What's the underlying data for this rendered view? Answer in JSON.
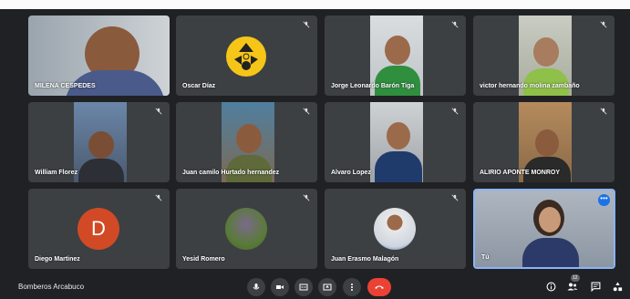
{
  "meeting": {
    "title": "Bomberos Arcabuco"
  },
  "participants": [
    {
      "name": "MILENA CESPEDES"
    },
    {
      "name": "Oscar Díaz"
    },
    {
      "name": "Jorge Leonardo Barón Tiga"
    },
    {
      "name": "victor hernando molina zambaño"
    },
    {
      "name": "William Florez"
    },
    {
      "name": "Juan camilo Hurtado hernandez"
    },
    {
      "name": "Alvaro Lopez"
    },
    {
      "name": "ALIRIO APONTE MONROY"
    },
    {
      "name": "Diego Martinez",
      "initial": "D"
    },
    {
      "name": "Yesid Romero"
    },
    {
      "name": "Juan Erasmo Malagón"
    },
    {
      "name": "Tú"
    }
  ],
  "people_count": "12",
  "colors": {
    "tile": "#3c4043",
    "hangup": "#ea4335",
    "accent": "#8ab4f8",
    "avatar_d": "#d14a25"
  }
}
